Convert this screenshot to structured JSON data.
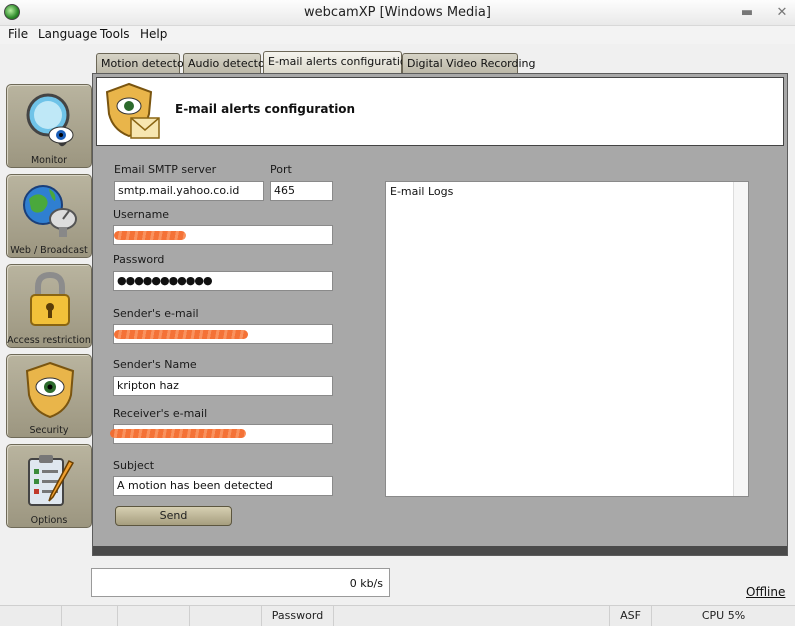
{
  "window": {
    "title": "webcamXP [Windows Media]"
  },
  "menu": [
    "File",
    "Language",
    "Tools",
    "Help"
  ],
  "sidebar": {
    "items": [
      {
        "label": "Monitor"
      },
      {
        "label": "Web / Broadcast"
      },
      {
        "label": "Access restriction"
      },
      {
        "label": "Security"
      },
      {
        "label": "Options"
      }
    ]
  },
  "tabs": [
    {
      "label": "Motion detector"
    },
    {
      "label": "Audio detector"
    },
    {
      "label": "E-mail alerts configuration",
      "active": true
    },
    {
      "label": "Digital Video Recording"
    }
  ],
  "panel": {
    "title": "E-mail alerts configuration",
    "smtp": {
      "label": "Email SMTP server",
      "value": "smtp.mail.yahoo.co.id"
    },
    "port": {
      "label": "Port",
      "value": "465"
    },
    "username": {
      "label": "Username"
    },
    "password": {
      "label": "Password",
      "value": "●●●●●●●●●●●"
    },
    "sender_email": {
      "label": "Sender's e-mail"
    },
    "sender_name": {
      "label": "Sender's Name",
      "value": "kripton haz"
    },
    "receiver_email": {
      "label": "Receiver's e-mail"
    },
    "subject": {
      "label": "Subject",
      "value": "A motion has been detected"
    },
    "send_label": "Send",
    "logs_label": "E-mail Logs"
  },
  "speed": "0 kb/s",
  "offline_label": "Offline",
  "status": {
    "password": "Password",
    "format": "ASF",
    "cpu": "CPU 5%"
  },
  "colors": {
    "accent_tan": "#b9b49f",
    "panel_grey": "#a8a8a8",
    "redaction": "#f46a2c"
  }
}
